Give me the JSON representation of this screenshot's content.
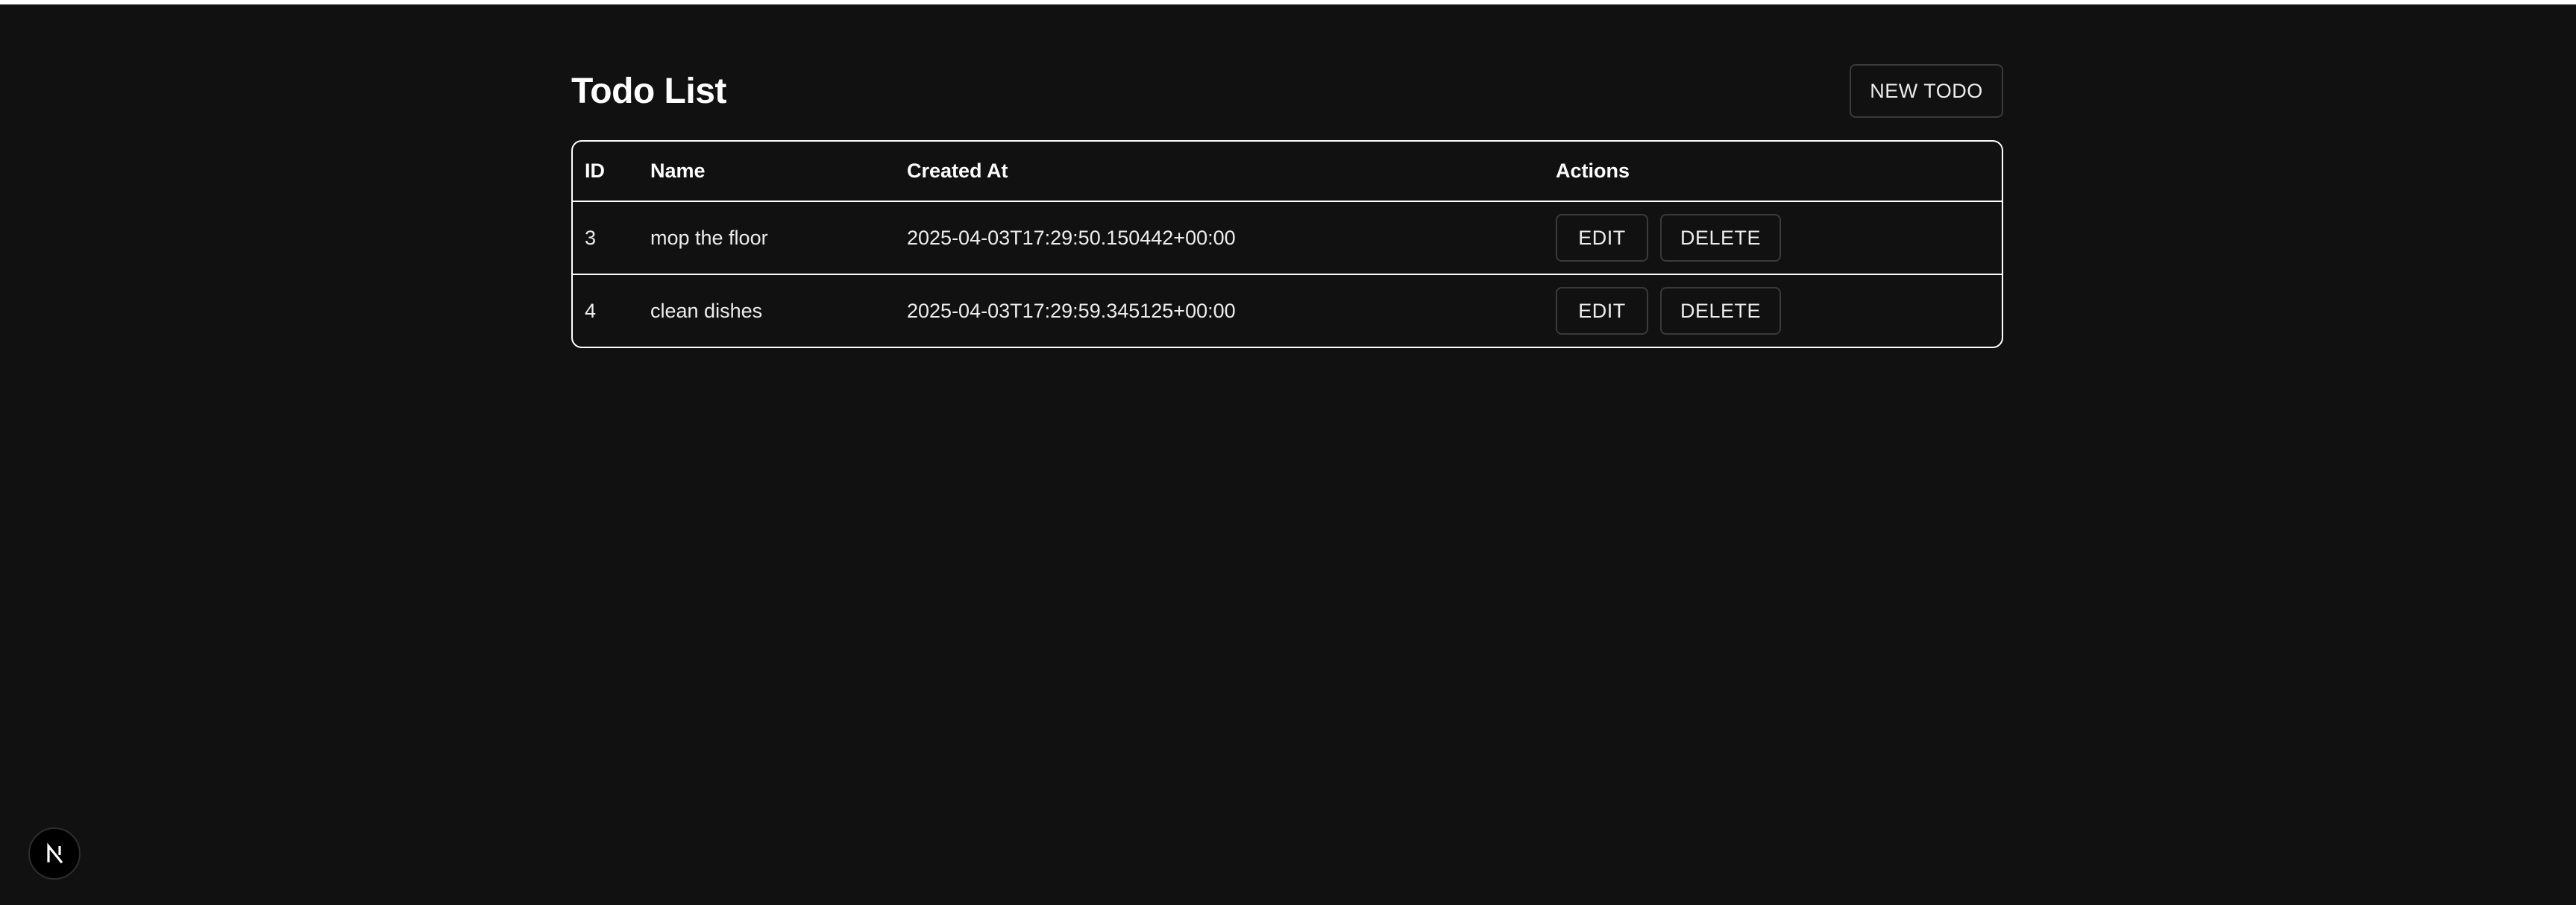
{
  "page": {
    "title": "Todo List",
    "new_button": "NEW TODO"
  },
  "table": {
    "headers": {
      "id": "ID",
      "name": "Name",
      "created_at": "Created At",
      "actions": "Actions"
    },
    "rows": [
      {
        "id": "3",
        "name": "mop the floor",
        "created_at": "2025-04-03T17:29:50.150442+00:00",
        "edit_label": "EDIT",
        "delete_label": "DELETE"
      },
      {
        "id": "4",
        "name": "clean dishes",
        "created_at": "2025-04-03T17:29:59.345125+00:00",
        "edit_label": "EDIT",
        "delete_label": "DELETE"
      }
    ]
  },
  "dev_badge": {
    "icon": "nextjs-logo-icon"
  },
  "colors": {
    "background": "#111111",
    "text": "#ededed",
    "border": "#ffffff",
    "button_border": "#3a3a3a"
  }
}
